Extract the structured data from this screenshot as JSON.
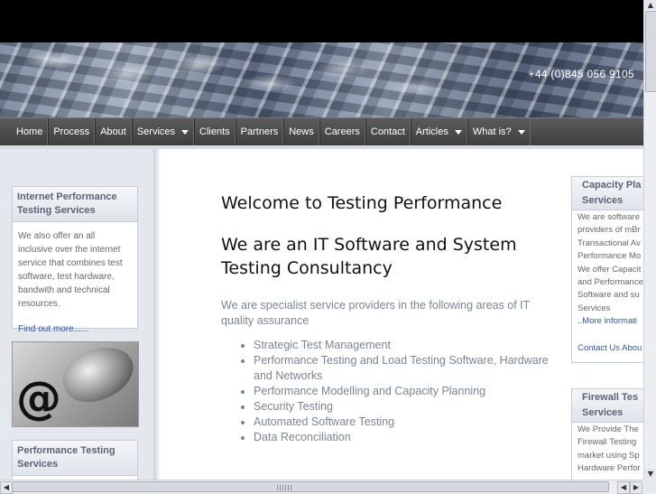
{
  "header": {
    "phone": "+44 (0)845 056 9105"
  },
  "nav": [
    {
      "label": "Home",
      "dropdown": false
    },
    {
      "label": "Process",
      "dropdown": false
    },
    {
      "label": "About",
      "dropdown": false
    },
    {
      "label": "Services",
      "dropdown": true
    },
    {
      "label": "Clients",
      "dropdown": false
    },
    {
      "label": "Partners",
      "dropdown": false
    },
    {
      "label": "News",
      "dropdown": false
    },
    {
      "label": "Careers",
      "dropdown": false
    },
    {
      "label": "Contact",
      "dropdown": false
    },
    {
      "label": "Articles",
      "dropdown": true
    },
    {
      "label": "What is?",
      "dropdown": true
    }
  ],
  "sidebar": {
    "box1": {
      "title": "Internet Performance Testing Services",
      "body": "We also offer an all inclusive over the internet service that combines test software, test hardware, bandwith and technical resources.",
      "link": "Find out more......"
    },
    "box2": {
      "title": "Performance Testing Services"
    }
  },
  "main": {
    "heading1": "Welcome to Testing Performance",
    "heading2": "We are an IT Software and System Testing Consultancy",
    "intro": "We are specialist service providers in the following areas of IT quality assurance",
    "services": [
      "Strategic Test Management",
      "Performance Testing and Load Testing Software, Hardware and Networks",
      "Performance Modelling and Capacity Planning",
      "Security Testing",
      "Automated Software Testing",
      "Data Reconciliation"
    ]
  },
  "right": {
    "box1": {
      "title_lines": [
        "Capacity Pla",
        "Services"
      ],
      "lines": [
        "We are software",
        "providers of mBr",
        "Transactional Av",
        "Performance Mo",
        "We offer Capacit",
        "and Performance",
        "Software and su",
        "Services"
      ],
      "more": "..More informati",
      "contact": "Contact Us Abou"
    },
    "box2": {
      "title_lines": [
        "Firewall Tes",
        "Services"
      ],
      "lines": [
        "We Provide The",
        "Firewall Testing",
        "market using Sp",
        "Hardware Perfor"
      ]
    }
  },
  "icons": {
    "scroll_up": "▲",
    "scroll_down": "▼",
    "scroll_left": "◀",
    "scroll_right": "▶"
  }
}
